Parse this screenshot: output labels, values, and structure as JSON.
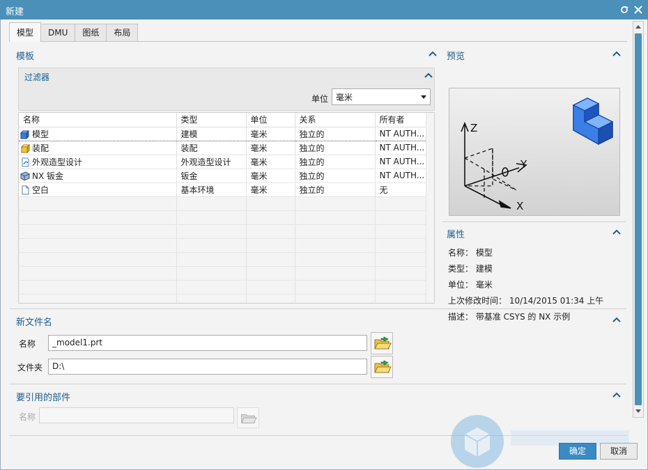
{
  "window": {
    "title": "新建"
  },
  "tabs": [
    "模型",
    "DMU",
    "图纸",
    "布局"
  ],
  "template": {
    "title": "模板",
    "filter": {
      "title": "过滤器",
      "unit_label": "单位",
      "unit_value": "毫米"
    },
    "columns": [
      "名称",
      "类型",
      "单位",
      "关系",
      "所有者"
    ],
    "rows": [
      {
        "icon": "model-icon",
        "name": "模型",
        "type": "建模",
        "unit": "毫米",
        "relation": "独立的",
        "owner": "NT AUTH..."
      },
      {
        "icon": "assembly-icon",
        "name": "装配",
        "type": "装配",
        "unit": "毫米",
        "relation": "独立的",
        "owner": "NT AUTH..."
      },
      {
        "icon": "shape-studio-icon",
        "name": "外观造型设计",
        "type": "外观造型设计",
        "unit": "毫米",
        "relation": "独立的",
        "owner": "NT AUTH..."
      },
      {
        "icon": "sheet-metal-icon",
        "name": "NX 钣金",
        "type": "钣金",
        "unit": "毫米",
        "relation": "独立的",
        "owner": "NT AUTH..."
      },
      {
        "icon": "blank-icon",
        "name": "空白",
        "type": "基本环境",
        "unit": "毫米",
        "relation": "独立的",
        "owner": "无"
      }
    ]
  },
  "preview": {
    "title": "预览",
    "axis_labels": {
      "z": "Z",
      "y": "Y",
      "x": "X"
    }
  },
  "properties": {
    "title": "属性",
    "name": "名称： 模型",
    "type": "类型： 建模",
    "unit": "单位： 毫米",
    "modified": "上次修改时间： 10/14/2015 01:34 上午",
    "description": "描述： 带基准 CSYS 的 NX 示例"
  },
  "new_file": {
    "title": "新文件名",
    "name_label": "名称",
    "name_value": "_model1.prt",
    "folder_label": "文件夹",
    "folder_value": "D:\\"
  },
  "referenced_part": {
    "title": "要引用的部件",
    "name_label": "名称",
    "name_value": ""
  },
  "buttons": {
    "ok": "确定",
    "cancel": "取消"
  },
  "colors": {
    "titlebar": "#4a90b8",
    "section_title": "#1b5f8f",
    "primary": "#3a8ac4"
  }
}
